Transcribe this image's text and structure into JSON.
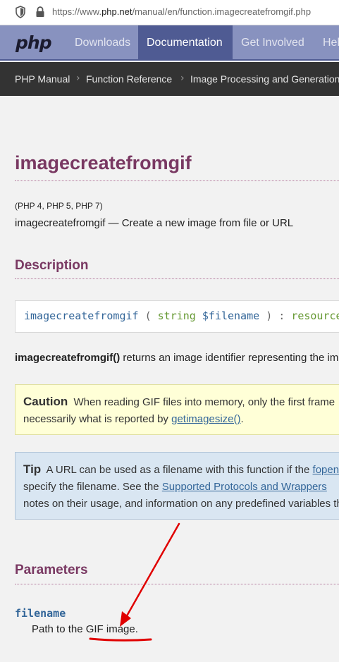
{
  "browser": {
    "url_prefix": "https://www.",
    "url_domain": "php.net",
    "url_path": "/manual/en/function.imagecreatefromgif.php"
  },
  "nav": {
    "logo": "php",
    "items": [
      "Downloads",
      "Documentation",
      "Get Involved",
      "Help"
    ],
    "active": "Documentation"
  },
  "breadcrumb": [
    "PHP Manual",
    "Function Reference",
    "Image Processing and Generation"
  ],
  "page": {
    "title": "imagecreatefromgif",
    "versions": "(PHP 4, PHP 5, PHP 7)",
    "purpose": "imagecreatefromgif — Create a new image from file or URL",
    "description_heading": "Description",
    "synopsis": {
      "name": "imagecreatefromgif",
      "open": "(",
      "param_type": "string",
      "param_name": "$filename",
      "close": ") :",
      "return_type": "resource"
    },
    "desc_func": "imagecreatefromgif()",
    "desc_text": " returns an image identifier representing the image obtained from the given filename.",
    "caution": {
      "label": "Caution",
      "text1": "When reading GIF files into memory, only the first frame is returned in the image resource. The size of the image is not",
      "text2": "necessarily what is reported by ",
      "link": "getimagesize()",
      "text3": "."
    },
    "tip": {
      "label": "Tip",
      "text1": "A URL can be used as a filename with this function if the ",
      "link1": "fopen wrappers",
      "text2": "specify the filename. See the ",
      "link2": "Supported Protocols and Wrappers",
      "text3": "notes on their usage, and information on any predefined variables they may provide."
    },
    "parameters_heading": "Parameters",
    "param_name": "filename",
    "param_desc": "Path to the GIF image."
  },
  "colors": {
    "nav_bg": "#8892bf",
    "nav_active": "#4f5b93",
    "heading": "#793862",
    "annotation": "#e00000"
  }
}
